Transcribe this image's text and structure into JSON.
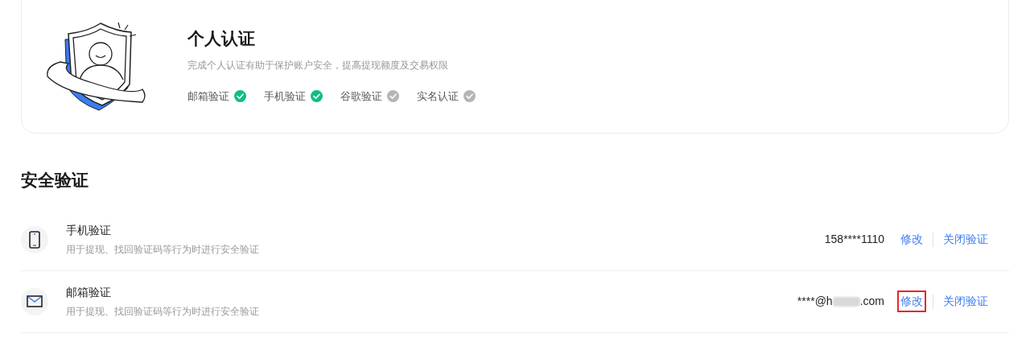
{
  "identity_card": {
    "title": "个人认证",
    "description": "完成个人认证有助于保护账户安全，提高提现额度及交易权限",
    "checks": [
      {
        "label": "邮箱验证",
        "checked": true
      },
      {
        "label": "手机验证",
        "checked": true
      },
      {
        "label": "谷歌验证",
        "checked": false
      },
      {
        "label": "实名认证",
        "checked": false
      }
    ]
  },
  "security": {
    "title": "安全验证",
    "rows": [
      {
        "kind": "phone",
        "title": "手机验证",
        "description": "用于提现、找回验证码等行为时进行安全验证",
        "value": "158****1110",
        "value_blurred": false,
        "actions": [
          {
            "label": "修改",
            "highlighted": false
          },
          {
            "label": "关闭验证",
            "highlighted": false
          }
        ]
      },
      {
        "kind": "email",
        "title": "邮箱验证",
        "description": "用于提现、找回验证码等行为时进行安全验证",
        "value": "****@h",
        "value_blurred": true,
        "value_end": ".com",
        "actions": [
          {
            "label": "修改",
            "highlighted": true
          },
          {
            "label": "关闭验证",
            "highlighted": false
          }
        ]
      }
    ]
  }
}
